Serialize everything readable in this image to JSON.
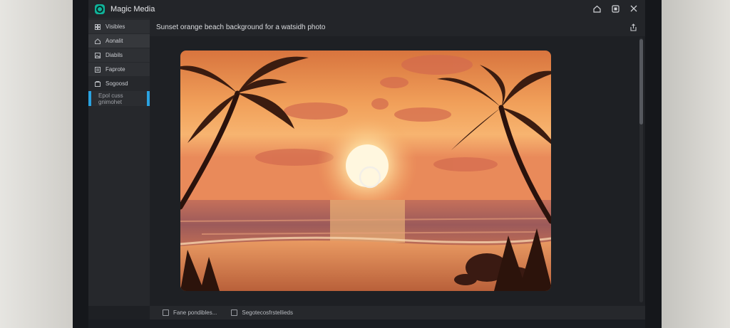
{
  "window": {
    "title": "Magic Media"
  },
  "sidebar": {
    "items": [
      {
        "label": "Visibles",
        "icon": "grid-icon"
      },
      {
        "label": "Aonalit",
        "icon": "home-icon"
      },
      {
        "label": "Diabils",
        "icon": "image-icon"
      },
      {
        "label": "Faprote",
        "icon": "layers-icon"
      },
      {
        "label": "Sogoosd",
        "icon": "box-icon"
      },
      {
        "label": "Epol cuss gnimohet",
        "icon": ""
      }
    ]
  },
  "prompt": {
    "text": "Sunset orange beach background for a watsidh photo",
    "action_icon": "share-icon"
  },
  "canvas": {
    "image_alt": "sunset beach with palm trees",
    "loading_icon": "spinner-icon"
  },
  "status": {
    "items": [
      {
        "label": "Fane pondibles...",
        "icon": "file-icon"
      },
      {
        "label": "Segotecosfrstellieds",
        "icon": "settings-icon"
      }
    ]
  },
  "colors": {
    "accent": "#10b39a",
    "highlight": "#2aa2e0",
    "background": "#1e2024"
  }
}
